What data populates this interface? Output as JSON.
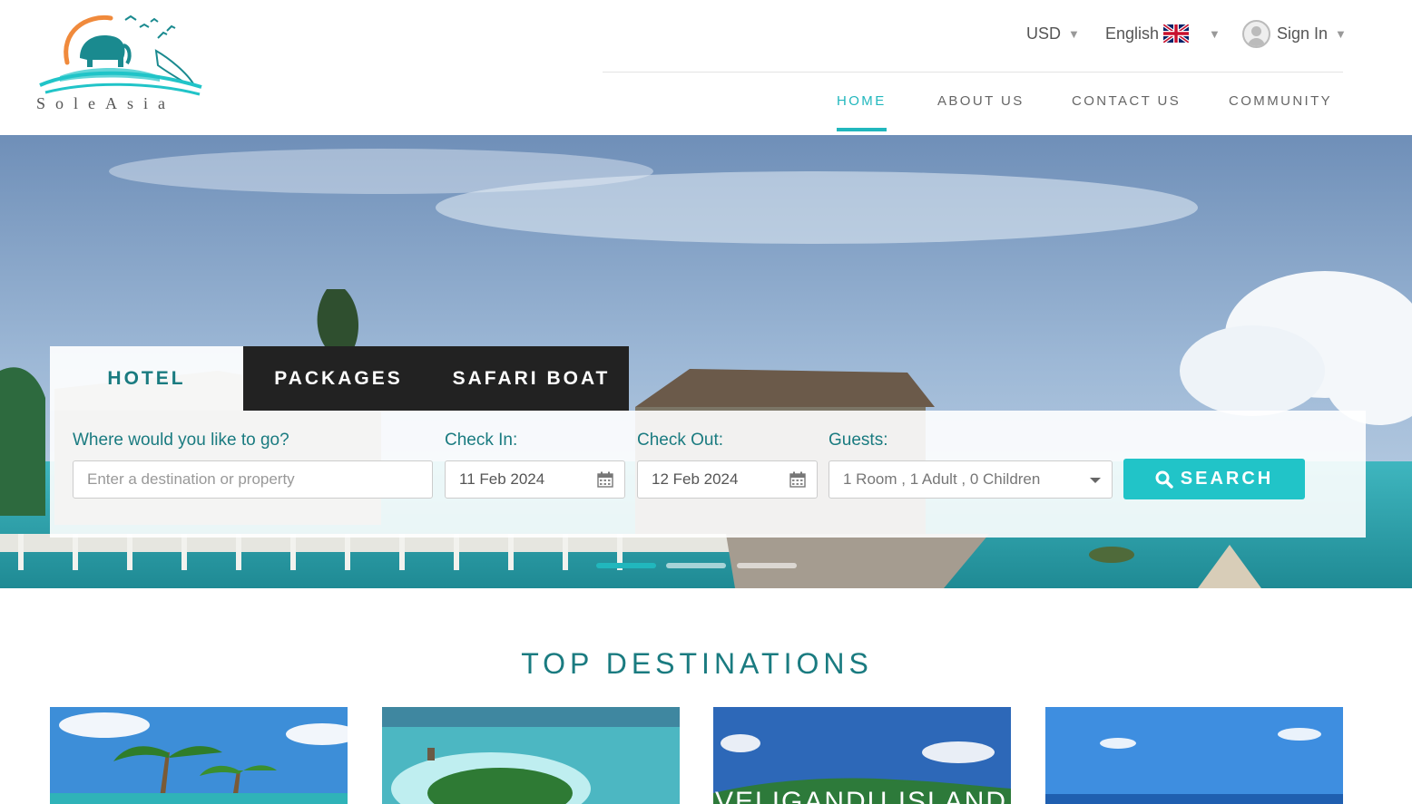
{
  "brand": {
    "name": "SoleAsia",
    "logo_icon": "elephant-dolphin-sun-logo"
  },
  "topbar": {
    "currency": "USD",
    "language": "English",
    "flag_icon": "uk-flag-icon",
    "signin": "Sign In"
  },
  "nav": {
    "items": [
      {
        "label": "HOME",
        "active": true
      },
      {
        "label": "ABOUT US",
        "active": false
      },
      {
        "label": "CONTACT US",
        "active": false
      },
      {
        "label": "COMMUNITY",
        "active": false
      }
    ]
  },
  "search": {
    "tabs": [
      {
        "label": "HOTEL",
        "active": true
      },
      {
        "label": "PACKAGES",
        "active": false
      },
      {
        "label": "SAFARI BOAT",
        "active": false
      }
    ],
    "destination": {
      "label": "Where would you like to go?",
      "placeholder": "Enter a destination or property",
      "value": ""
    },
    "checkin": {
      "label": "Check In:",
      "value": "11 Feb 2024"
    },
    "checkout": {
      "label": "Check Out:",
      "value": "12 Feb 2024"
    },
    "guests": {
      "label": "Guests:",
      "value": "1 Room , 1 Adult , 0 Children"
    },
    "button": "SEARCH"
  },
  "carousel": {
    "slides": 3,
    "active": 1
  },
  "destinations": {
    "title": "TOP DESTINATIONS",
    "cards": [
      {
        "label": ""
      },
      {
        "label": ""
      },
      {
        "label": "VELIGANDU ISLAND"
      },
      {
        "label": ""
      }
    ]
  },
  "colors": {
    "accent": "#21b7bd",
    "accent_dark": "#1a7b80",
    "dark_tab": "#222222"
  }
}
